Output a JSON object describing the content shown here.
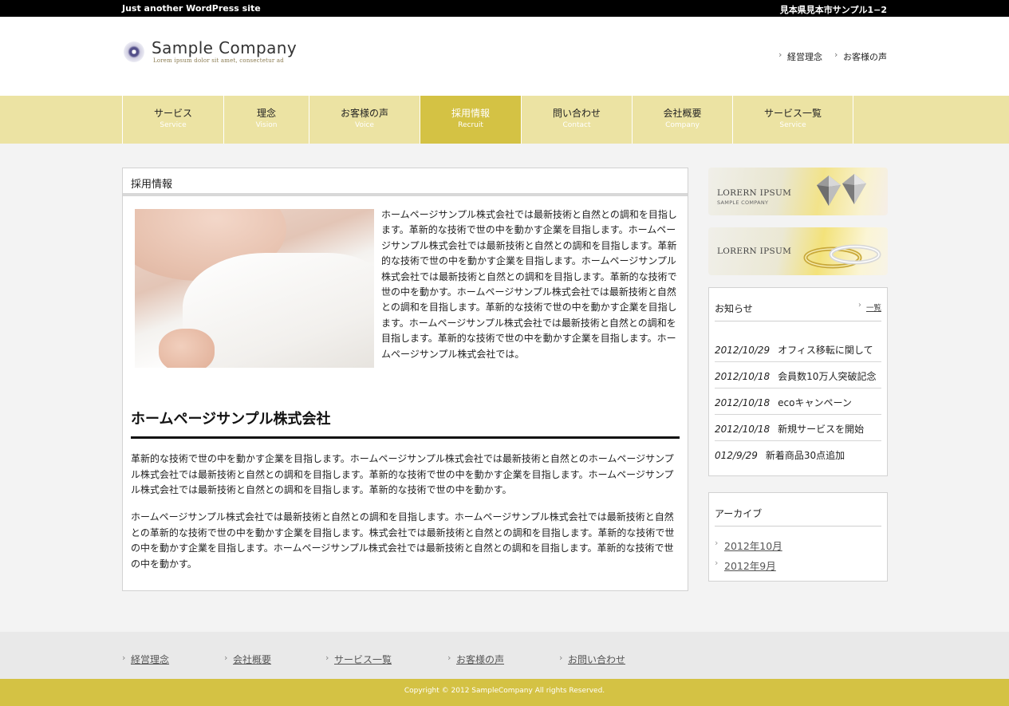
{
  "topbar": {
    "tagline": "Just another WordPress site",
    "address": "見本県見本市サンプル1−2"
  },
  "header": {
    "logo_name": "Sample Company",
    "logo_sub": "Lorem ipsum dolor sit amet, consectetur ad",
    "links": [
      "経営理念",
      "お客様の声"
    ]
  },
  "nav": {
    "items": [
      {
        "jp": "サービス",
        "en": "Service"
      },
      {
        "jp": "理念",
        "en": "Vision"
      },
      {
        "jp": "お客様の声",
        "en": "Voice"
      },
      {
        "jp": "採用情報",
        "en": "Recruit"
      },
      {
        "jp": "問い合わせ",
        "en": "Contact"
      },
      {
        "jp": "会社概要",
        "en": "Company"
      },
      {
        "jp": "サービス一覧",
        "en": "Service"
      }
    ],
    "active_index": 3
  },
  "main": {
    "title": "採用情報",
    "intro": "ホームページサンプル株式会社では最新技術と自然との調和を目指します。革新的な技術で世の中を動かす企業を目指します。ホームページサンプル株式会社では最新技術と自然との調和を目指します。革新的な技術で世の中を動かす企業を目指します。ホームページサンプル株式会社では最新技術と自然との調和を目指します。革新的な技術で世の中を動かす。ホームページサンプル株式会社では最新技術と自然との調和を目指します。革新的な技術で世の中を動かす企業を目指します。ホームページサンプル株式会社では最新技術と自然との調和を目指します。革新的な技術で世の中を動かす企業を目指します。ホームページサンプル株式会社では。",
    "heading": "ホームページサンプル株式会社",
    "para1": "革新的な技術で世の中を動かす企業を目指します。ホームページサンプル株式会社では最新技術と自然とのホームページサンプル株式会社では最新技術と自然との調和を目指します。革新的な技術で世の中を動かす企業を目指します。ホームページサンプル株式会社では最新技術と自然との調和を目指します。革新的な技術で世の中を動かす。",
    "para2": "ホームページサンプル株式会社では最新技術と自然との調和を目指します。ホームページサンプル株式会社では最新技術と自然との革新的な技術で世の中を動かす企業を目指します。株式会社では最新技術と自然との調和を目指します。革新的な技術で世の中を動かす企業を目指します。ホームページサンプル株式会社では最新技術と自然との調和を目指します。革新的な技術で世の中を動かす。"
  },
  "sidebar": {
    "banner1": {
      "title": "LORERN IPSUM",
      "sub": "SAMPLE COMPANY"
    },
    "banner2": {
      "title": "LORERN IPSUM"
    },
    "news": {
      "title": "お知らせ",
      "more": "一覧",
      "items": [
        {
          "date": "2012/10/29",
          "title": "オフィス移転に関して"
        },
        {
          "date": "2012/10/18",
          "title": "会員数10万人突破記念"
        },
        {
          "date": "2012/10/18",
          "title": "ecoキャンペーン"
        },
        {
          "date": "2012/10/18",
          "title": "新規サービスを開始"
        },
        {
          "date": "012/9/29",
          "title": "新着商品30点追加"
        }
      ]
    },
    "archive": {
      "title": "アーカイブ",
      "items": [
        "2012年10月",
        "2012年9月"
      ]
    }
  },
  "footer": {
    "links": [
      "経営理念",
      "会社概要",
      "サービス一覧",
      "お客様の声",
      "お問い合わせ"
    ],
    "copyright": "Copyright © 2012 SampleCompany All rights Reserved."
  },
  "colors": {
    "accent": "#d4c244",
    "nav_bg": "#ece3a3",
    "topbar": "#000000"
  },
  "icons": {
    "logo_mark": "circle-logo-icon",
    "link_bullet": "chevron-right-icon"
  }
}
